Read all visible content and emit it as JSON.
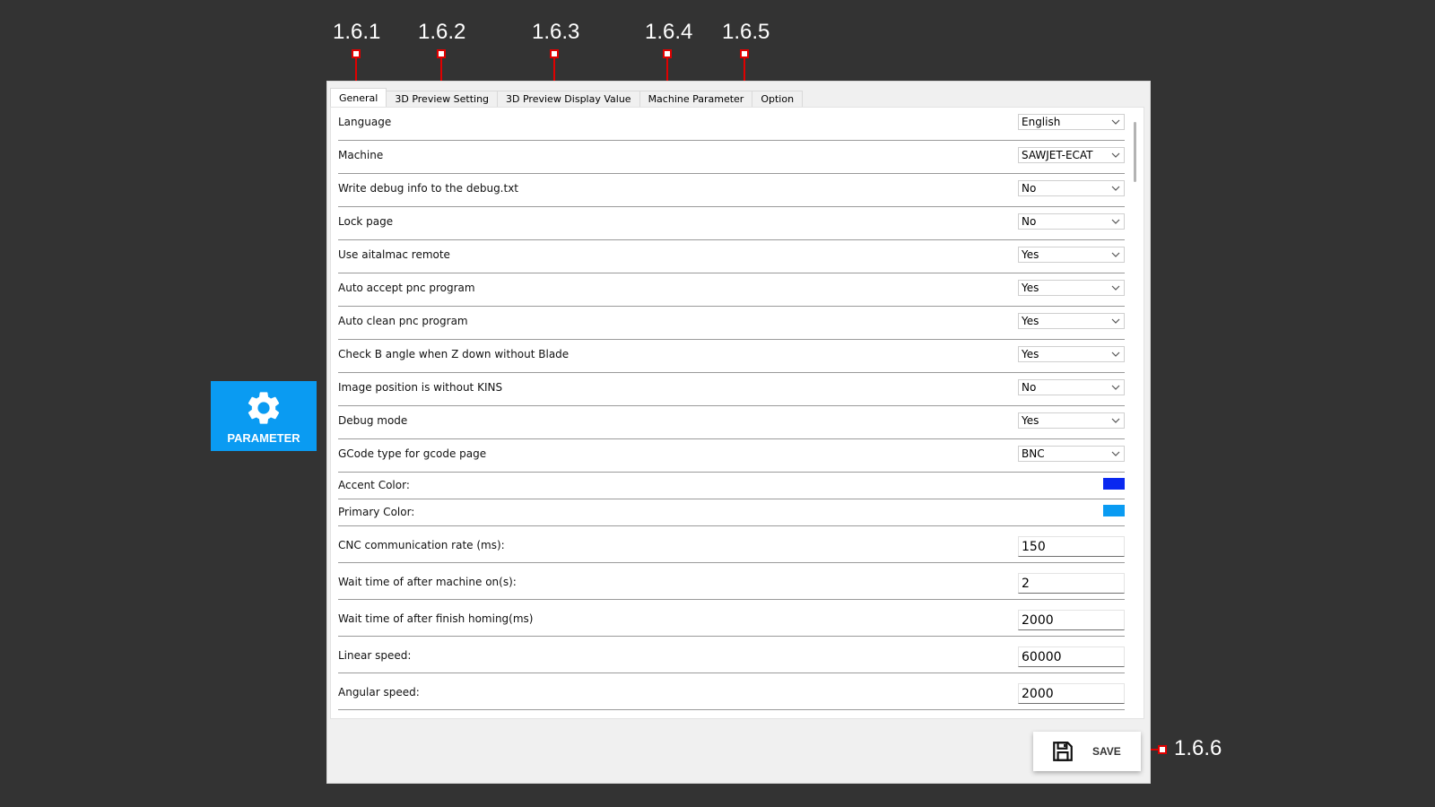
{
  "callouts": {
    "general": "1.6.1",
    "preview_setting": "1.6.2",
    "preview_display": "1.6.3",
    "machine_param": "1.6.4",
    "option": "1.6.5",
    "save": "1.6.6"
  },
  "sidebar": {
    "parameter_label": "PARAMETER",
    "icon": "gear-icon",
    "color": "#0a9bf2"
  },
  "tabs": [
    {
      "label": "General",
      "active": true
    },
    {
      "label": "3D Preview Setting",
      "active": false
    },
    {
      "label": "3D Preview Display Value",
      "active": false
    },
    {
      "label": "Machine Parameter",
      "active": false
    },
    {
      "label": "Option",
      "active": false
    }
  ],
  "settings": [
    {
      "label": "Language",
      "type": "select",
      "value": "English"
    },
    {
      "label": "Machine",
      "type": "select",
      "value": "SAWJET-ECAT"
    },
    {
      "label": "Write debug info to the debug.txt",
      "type": "select",
      "value": "No"
    },
    {
      "label": "Lock page",
      "type": "select",
      "value": "No"
    },
    {
      "label": "Use aitalmac remote",
      "type": "select",
      "value": "Yes"
    },
    {
      "label": "Auto accept pnc program",
      "type": "select",
      "value": "Yes"
    },
    {
      "label": "Auto clean pnc program",
      "type": "select",
      "value": "Yes"
    },
    {
      "label": "Check B angle when Z down without Blade",
      "type": "select",
      "value": "Yes"
    },
    {
      "label": "Image position is without KINS",
      "type": "select",
      "value": "No"
    },
    {
      "label": "Debug mode",
      "type": "select",
      "value": "Yes"
    },
    {
      "label": "GCode type for gcode page",
      "type": "select",
      "value": "BNC"
    },
    {
      "label": "Accent Color:",
      "type": "color",
      "value": "#0a28f0"
    },
    {
      "label": "Primary Color:",
      "type": "color",
      "value": "#0a9bf2"
    },
    {
      "label": "CNC communication rate (ms):",
      "type": "input",
      "value": "150"
    },
    {
      "label": "Wait time of after machine on(s):",
      "type": "input",
      "value": "2"
    },
    {
      "label": "Wait time of after finish homing(ms)",
      "type": "input",
      "value": "2000"
    },
    {
      "label": "Linear speed:",
      "type": "input",
      "value": "60000"
    },
    {
      "label": "Angular speed:",
      "type": "input",
      "value": "2000"
    }
  ],
  "save": {
    "label": "SAVE",
    "icon": "floppy-disk-icon"
  }
}
